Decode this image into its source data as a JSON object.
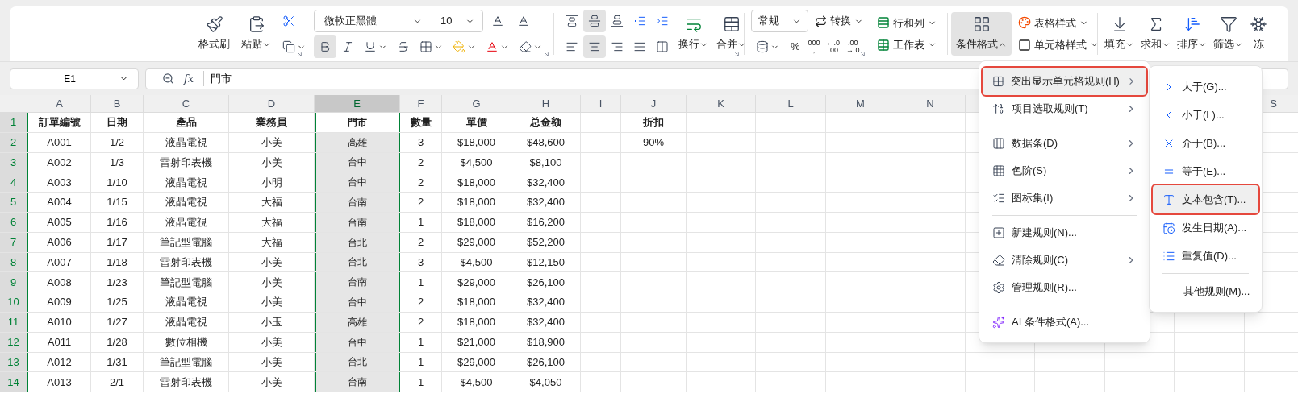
{
  "ribbon": {
    "clipboard": [
      {
        "label": "格式刷"
      },
      {
        "label": "粘贴"
      }
    ],
    "font": {
      "name": "微軟正黑體",
      "size": "10",
      "bold": true,
      "italic": false,
      "underline": false
    },
    "alignment": {
      "vertical": [
        {
          "selected": false
        },
        {
          "selected": true
        },
        {
          "selected": false
        }
      ],
      "horizontal": [
        {
          "selected": false
        },
        {
          "selected": true
        },
        {
          "selected": false
        },
        {
          "selected": false
        }
      ],
      "wrap_label": "换行",
      "merge_label": "合并"
    },
    "number": {
      "format": "常规",
      "convert_label": "转换",
      "percent": "%",
      "thousands": [
        "000",
        ","
      ],
      "decrease_decimal": [
        "←.0",
        ".00"
      ],
      "increase_decimal": [
        ".00",
        "→.0"
      ]
    },
    "cells": [
      {
        "label": "行和列"
      },
      {
        "label": "工作表"
      }
    ],
    "styles": {
      "conditional": {
        "label": "条件格式",
        "expanded": true
      },
      "table_style": "表格样式",
      "cell_style": "单元格样式"
    },
    "editing": [
      {
        "label": "填充"
      },
      {
        "label": "求和"
      },
      {
        "label": "排序"
      },
      {
        "label": "筛选"
      },
      {
        "label": "冻"
      }
    ]
  },
  "formula_bar": {
    "name_box": "E1",
    "fx": "fx",
    "value": "門市"
  },
  "columns": [
    {
      "label": "A",
      "selected": false
    },
    {
      "label": "B",
      "selected": false
    },
    {
      "label": "C",
      "selected": false
    },
    {
      "label": "D",
      "selected": false
    },
    {
      "label": "E",
      "selected": true
    },
    {
      "label": "F",
      "selected": false
    },
    {
      "label": "G",
      "selected": false
    },
    {
      "label": "H",
      "selected": false
    },
    {
      "label": "I",
      "selected": false
    },
    {
      "label": "J",
      "selected": false
    },
    {
      "label": "K",
      "selected": false
    },
    {
      "label": "L",
      "selected": false
    },
    {
      "label": "M",
      "selected": false
    },
    {
      "label": "N",
      "selected": false
    },
    {
      "label": "S",
      "selected": false
    }
  ],
  "header_row": {
    "number": "1",
    "selected": true,
    "cells": [
      "訂單編號",
      "日期",
      "產品",
      "業務員",
      "門市",
      "數量",
      "單價",
      "总金额",
      null,
      "折扣"
    ]
  },
  "rows": [
    {
      "number": "2",
      "selected": true,
      "cells": [
        "A001",
        "1/2",
        "液晶電視",
        "小美",
        "高雄",
        "3",
        "$18,000",
        "$48,600",
        null,
        "90%"
      ]
    },
    {
      "number": "3",
      "selected": true,
      "cells": [
        "A002",
        "1/3",
        "雷射印表機",
        "小美",
        "台中",
        "2",
        "$4,500",
        "$8,100"
      ]
    },
    {
      "number": "4",
      "selected": true,
      "cells": [
        "A003",
        "1/10",
        "液晶電視",
        "小明",
        "台中",
        "2",
        "$18,000",
        "$32,400"
      ]
    },
    {
      "number": "5",
      "selected": true,
      "cells": [
        "A004",
        "1/15",
        "液晶電視",
        "大福",
        "台南",
        "2",
        "$18,000",
        "$32,400"
      ]
    },
    {
      "number": "6",
      "selected": true,
      "cells": [
        "A005",
        "1/16",
        "液晶電視",
        "大福",
        "台南",
        "1",
        "$18,000",
        "$16,200"
      ]
    },
    {
      "number": "7",
      "selected": true,
      "cells": [
        "A006",
        "1/17",
        "筆記型電腦",
        "大福",
        "台北",
        "2",
        "$29,000",
        "$52,200"
      ]
    },
    {
      "number": "8",
      "selected": true,
      "cells": [
        "A007",
        "1/18",
        "雷射印表機",
        "小美",
        "台北",
        "3",
        "$4,500",
        "$12,150"
      ]
    },
    {
      "number": "9",
      "selected": true,
      "cells": [
        "A008",
        "1/23",
        "筆記型電腦",
        "小美",
        "台南",
        "1",
        "$29,000",
        "$26,100"
      ]
    },
    {
      "number": "10",
      "selected": true,
      "cells": [
        "A009",
        "1/25",
        "液晶電視",
        "小美",
        "台中",
        "2",
        "$18,000",
        "$32,400"
      ]
    },
    {
      "number": "11",
      "selected": true,
      "cells": [
        "A010",
        "1/27",
        "液晶電視",
        "小玉",
        "高雄",
        "2",
        "$18,000",
        "$32,400"
      ]
    },
    {
      "number": "12",
      "selected": true,
      "cells": [
        "A011",
        "1/28",
        "數位相機",
        "小美",
        "台中",
        "1",
        "$21,000",
        "$18,900"
      ]
    },
    {
      "number": "13",
      "selected": true,
      "cells": [
        "A012",
        "1/31",
        "筆記型電腦",
        "小美",
        "台北",
        "1",
        "$29,000",
        "$26,100"
      ]
    },
    {
      "number": "14",
      "selected": true,
      "cells": [
        "A013",
        "2/1",
        "雷射印表機",
        "小美",
        "台南",
        "1",
        "$4,500",
        "$4,050"
      ]
    }
  ],
  "menu": {
    "groups": [
      [
        {
          "label": "突出显示单元格规则(H)",
          "submenu": true,
          "selected": true
        },
        {
          "label": "项目选取规则(T)",
          "submenu": true,
          "selected": false
        }
      ],
      [
        {
          "label": "数据条(D)",
          "submenu": true,
          "selected": false
        },
        {
          "label": "色阶(S)",
          "submenu": true,
          "selected": false
        },
        {
          "label": "图标集(I)",
          "submenu": true,
          "selected": false
        }
      ],
      [
        {
          "label": "新建规则(N)...",
          "submenu": false,
          "selected": false
        },
        {
          "label": "清除规则(C)",
          "submenu": true,
          "selected": false
        },
        {
          "label": "管理规则(R)...",
          "submenu": false,
          "selected": false
        }
      ],
      [
        {
          "label": "AI 条件格式(A)...",
          "submenu": false,
          "selected": false
        }
      ]
    ]
  },
  "submenu": {
    "groups": [
      [
        {
          "label": "大于(G)...",
          "selected": false
        },
        {
          "label": "小于(L)...",
          "selected": false
        },
        {
          "label": "介于(B)...",
          "selected": false
        },
        {
          "label": "等于(E)...",
          "selected": false
        },
        {
          "label": "文本包含(T)...",
          "selected": true
        },
        {
          "label": "发生日期(A)...",
          "selected": false
        },
        {
          "label": "重复值(D)...",
          "selected": false
        }
      ],
      [
        {
          "label": "其他规则(M)...",
          "selected": false
        }
      ]
    ]
  }
}
